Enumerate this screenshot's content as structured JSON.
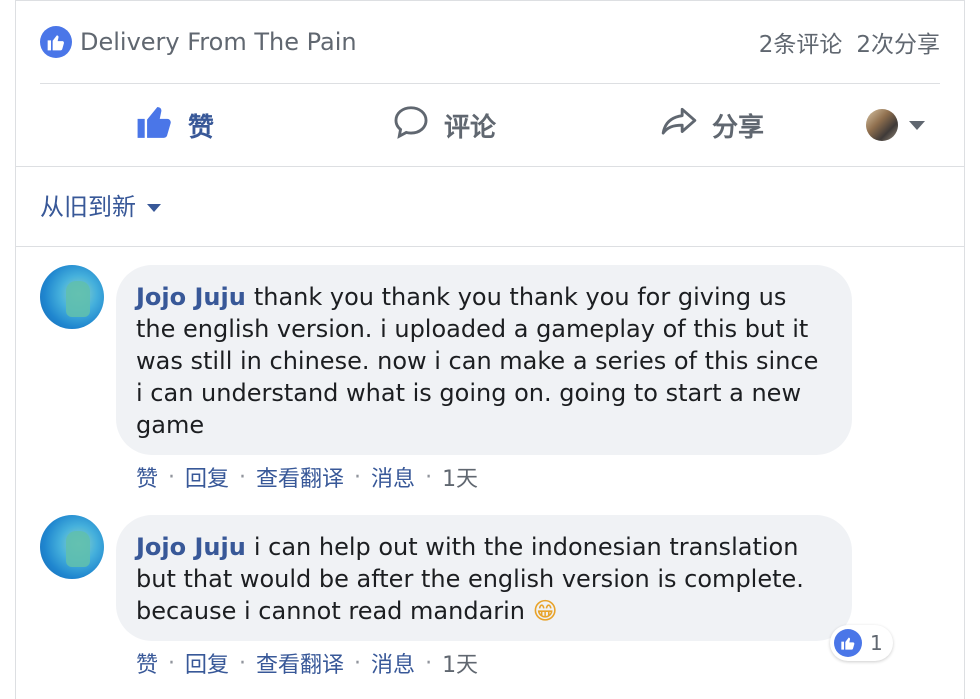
{
  "summary": {
    "post_title": "Delivery From The Pain",
    "comments_count": "2条评论",
    "shares_count": "2次分享",
    "like_icon": "thumbs-up-icon"
  },
  "actions": {
    "like_label": "赞",
    "comment_label": "评论",
    "share_label": "分享"
  },
  "sort": {
    "label": "从旧到新"
  },
  "comments": [
    {
      "author": "Jojo Juju",
      "text": "thank you thank you thank you for giving us the english version. i uploaded a gameplay of this but it was still in chinese. now i can make a series of this since i can understand what is going on. going to start a new game",
      "actions": [
        "赞",
        "回复",
        "查看翻译",
        "消息"
      ],
      "time": "1天"
    },
    {
      "author": "Jojo Juju",
      "text": "i can help out with the indonesian translation but that would be after the english version is complete. because i cannot read mandarin",
      "emoji": "😁",
      "reaction_count": "1",
      "actions": [
        "赞",
        "回复",
        "查看翻译",
        "消息"
      ],
      "time": "1天"
    }
  ],
  "colors": {
    "accent": "#385898",
    "like_blue": "#4a76e8",
    "muted": "#606770",
    "bubble": "#f0f2f5",
    "divider": "#dddfe2"
  }
}
